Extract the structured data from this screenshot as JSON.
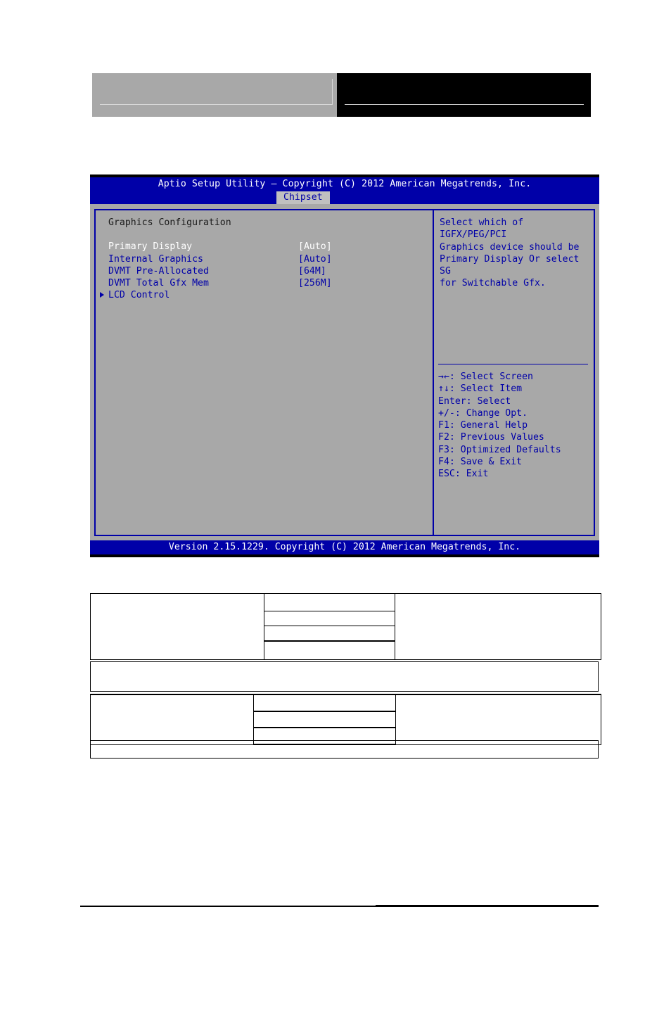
{
  "bios": {
    "title": "Aptio Setup Utility – Copyright (C) 2012 American Megatrends, Inc.",
    "tab": "Chipset",
    "section_title": "Graphics Configuration",
    "options": [
      {
        "label": "Primary Display",
        "value": "[Auto]",
        "selected": true
      },
      {
        "label": "Internal Graphics",
        "value": "[Auto]",
        "selected": false
      },
      {
        "label": "DVMT Pre-Allocated",
        "value": "[64M]",
        "selected": false
      },
      {
        "label": "DVMT Total Gfx Mem",
        "value": "[256M]",
        "selected": false
      }
    ],
    "submenu": {
      "label": "LCD Control"
    },
    "help_lines": [
      "Select which of IGFX/PEG/PCI",
      "Graphics device should be",
      "Primary Display Or select SG",
      "for Switchable Gfx."
    ],
    "nav_keys": [
      "→←: Select Screen",
      "↑↓: Select Item",
      "Enter: Select",
      "+/-: Change Opt.",
      "F1: General Help",
      "F2: Previous Values",
      "F3: Optimized Defaults",
      "F4: Save & Exit",
      "ESC: Exit"
    ],
    "footer": "Version 2.15.1229. Copyright (C) 2012 American Megatrends, Inc."
  },
  "colors": {
    "bios_blue": "#0000a8",
    "bios_gray": "#a8a8a8",
    "highlight_white": "#ffffff",
    "tab_gray": "#c0c0c0"
  }
}
